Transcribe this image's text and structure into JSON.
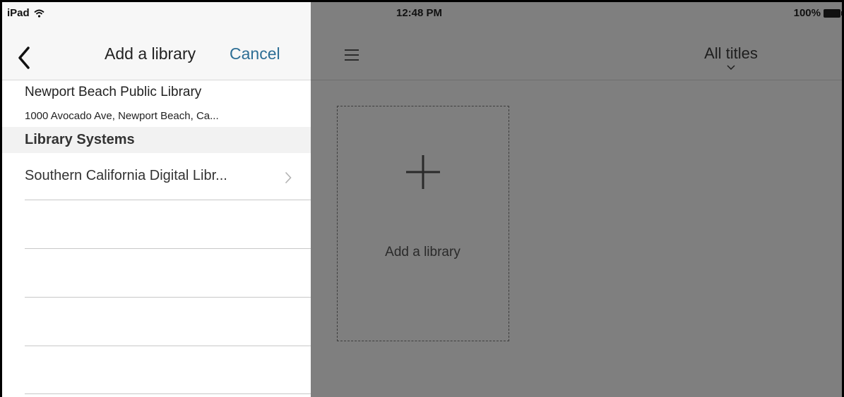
{
  "status_bar": {
    "device": "iPad",
    "time": "12:48 PM",
    "battery": "100%"
  },
  "side_panel": {
    "title": "Add a library",
    "cancel_label": "Cancel",
    "library": {
      "name": "Newport Beach Public Library",
      "address": "1000 Avocado Ave, Newport Beach, Ca..."
    },
    "section_title": "Library Systems",
    "systems": [
      {
        "name": "Southern California Digital Libr..."
      }
    ]
  },
  "main": {
    "view_title": "All titles",
    "add_card_label": "Add a library"
  },
  "colors": {
    "accent": "#2d6e95",
    "overlay": "#7f7f7f"
  }
}
